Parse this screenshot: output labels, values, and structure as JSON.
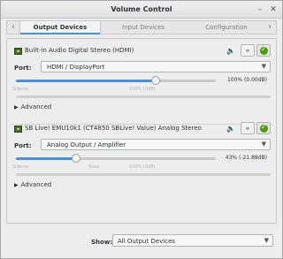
{
  "window": {
    "title": "Volume Control"
  },
  "tabs": [
    {
      "label": "Output Devices",
      "active": true
    },
    {
      "label": "Input Devices",
      "active": false
    },
    {
      "label": "Configuration",
      "active": false
    }
  ],
  "devices": [
    {
      "name": "Built-in Audio Digital Stereo (HDMI)",
      "port_label": "Port:",
      "port_value": "HDMI / DisplayPort",
      "volume_percent": 100,
      "volume_readout": "100% (0.00dB)",
      "ticks": [
        "Silence",
        "100% (0dB)"
      ],
      "advanced_label": "Advanced"
    },
    {
      "name": "SB Live! EMU10k1 (CT4850 SBLive! Value) Analog Stereo",
      "port_label": "Port:",
      "port_value": "Analog Output / Amplifier",
      "volume_percent": 43,
      "volume_readout": "43% (-21.88dB)",
      "ticks": [
        "Silence",
        "Base",
        "100% (0dB)"
      ],
      "advanced_label": "Advanced"
    }
  ],
  "footer": {
    "show_label": "Show:",
    "show_value": "All Output Devices"
  },
  "colors": {
    "accent": "#4a90d9",
    "default_icon": "#4e9a06"
  }
}
